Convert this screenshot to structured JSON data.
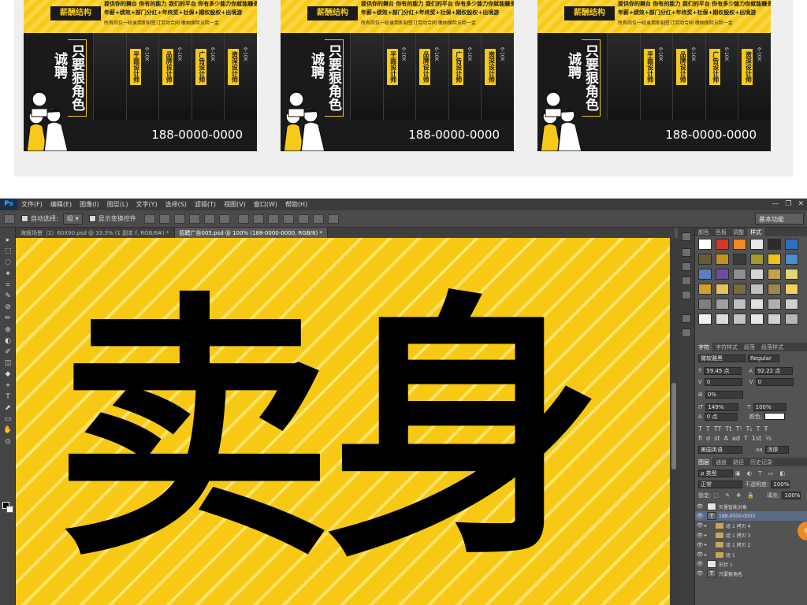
{
  "preview": {
    "posters": [
      {
        "badge": "薪酬结构",
        "top_line_1": "提供你的舞台 你有的能力 我们的平台 你有多少能力你就能赚多少钱",
        "top_line_2": "年薪+绩效+部门分红+年终奖+社保+期权股权+出境游",
        "top_line_3": "所有岗位一经录用即刻签订劳动合同  缴纳保险五险一金",
        "slogan_a": "诚聘",
        "slogan_b": "只要狠角色",
        "jobs": [
          {
            "title": "平面设计师",
            "salary": "6-10K"
          },
          {
            "title": "品牌设计师",
            "salary": "6-10K"
          },
          {
            "title": "广告设计师",
            "salary": "6-10K"
          },
          {
            "title": "资深设计师",
            "salary": "6-10K"
          }
        ],
        "phone": "188-0000-0000"
      }
    ]
  },
  "ps": {
    "logo": "Ps",
    "menu": [
      "文件(F)",
      "编辑(E)",
      "图像(I)",
      "图层(L)",
      "文字(Y)",
      "选择(S)",
      "滤镜(T)",
      "视图(V)",
      "窗口(W)",
      "帮助(H)"
    ],
    "window_buttons": [
      "—",
      "❐",
      "✕"
    ],
    "options": {
      "auto_select_label": "自动选择:",
      "auto_select_value": "组",
      "show_transform_label": "显示变换控件",
      "workspace": "基本功能"
    },
    "doc_tabs": [
      {
        "label": "海报场景（2）60X90.psd @ 33.3% (1 副本 f, RGB/8#) *",
        "active": false
      },
      {
        "label": "招聘广告005.psd @ 100% (188-0000-0000, RGB/8) *",
        "active": true
      }
    ],
    "tools": [
      "▸",
      "⬚",
      "◌",
      "✦",
      "⌗",
      "✎",
      "⊘",
      "✏",
      "⊕",
      "◐",
      "✐",
      "◫",
      "◆",
      "⌖",
      "T",
      "⬈",
      "▭",
      "✋",
      "⊙"
    ],
    "canvas_text": "卖身",
    "panels": {
      "top_tabs": [
        "颜色",
        "色板",
        "调整",
        "样式"
      ],
      "top_active": "样式",
      "char_tabs": [
        "字符",
        "字符样式",
        "段落",
        "段落样式"
      ],
      "char_active": "字符",
      "font_family": "微软雅黑",
      "font_style": "Regular",
      "font_size": "59.45 点",
      "leading": "92.22 点",
      "kerning": "0",
      "tracking": "0",
      "scale_h": "0%",
      "vertical_scale": "149%",
      "horizontal_scale": "100%",
      "baseline_shift": "0 点",
      "color_label": "颜色:",
      "language": "美国英语",
      "antialias": "浑厚",
      "layer_tabs": [
        "图层",
        "通道",
        "路径",
        "历史记录"
      ],
      "layer_active": "图层",
      "kind_label": "ρ 类型",
      "blend_mode": "正常",
      "opacity_label": "不透明度:",
      "opacity": "100%",
      "lock_label": "锁定:",
      "fill_label": "填充:",
      "fill": "100%",
      "layers": [
        {
          "name": "矢量智能对象",
          "type": "smart",
          "selected": false
        },
        {
          "name": "188-0000-0000",
          "type": "text",
          "selected": true
        },
        {
          "name": "组 1 拷贝 4",
          "type": "group",
          "selected": false
        },
        {
          "name": "组 1 拷贝 3",
          "type": "group",
          "selected": false
        },
        {
          "name": "组 1 拷贝 2",
          "type": "group",
          "selected": false
        },
        {
          "name": "组 1",
          "type": "group",
          "selected": false
        },
        {
          "name": "形状 1",
          "type": "shape",
          "selected": false
        },
        {
          "name": "只要狠角色",
          "type": "text",
          "selected": false
        }
      ]
    },
    "badge": "Bi"
  }
}
